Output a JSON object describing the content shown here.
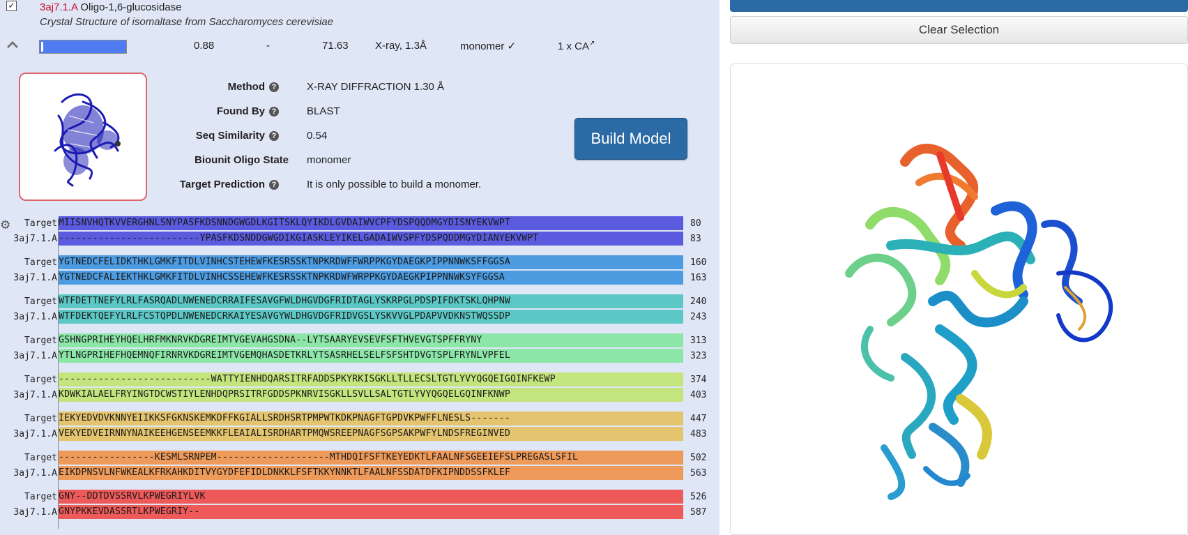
{
  "result": {
    "template_id": "3aj7.1.A",
    "name": "Oligo-1,6-glucosidase",
    "description": "Crystal Structure of isomaltase from Saccharomyces cerevisiae",
    "coverage_fraction": 0.97,
    "gmqe": "0.88",
    "qmean": "-",
    "identity": "71.63",
    "method_short": "X-ray, 1.3Å",
    "oligo_state": "monomer ✓",
    "ligands": "1 x CA"
  },
  "details": {
    "rows": [
      {
        "label": "Method",
        "value": "X-RAY DIFFRACTION 1.30 Å",
        "help": true
      },
      {
        "label": "Found By",
        "value": "BLAST",
        "help": true
      },
      {
        "label": "Seq Similarity",
        "value": "0.54",
        "help": true
      },
      {
        "label": "Biounit Oligo State",
        "value": "monomer",
        "help": false
      },
      {
        "label": "Target Prediction",
        "value": "It is only possible to build a monomer.",
        "help": true
      }
    ]
  },
  "buttons": {
    "build_model": "Build Model",
    "clear_selection": "Clear Selection"
  },
  "alignment": {
    "blocks": [
      {
        "rows": [
          {
            "label": "Target",
            "seq": "MIISNVHQTKVVERGHNLSNYPASFKDSNNDGWGDLKGITSKLQYIKDLGVDAIWVCPFYDSPQQDMGYDISNYEKVWPT",
            "end": "80",
            "color": "#5b5bdf"
          },
          {
            "label": "3aj7.1.A",
            "seq": "-------------------------YPASFKDSNDDGWGDIKGIASKLEYIKELGADAIWVSPFYDSPQDDMGYDIANYEKVWPT",
            "end": "83",
            "color": "#5b5bdf"
          }
        ]
      },
      {
        "rows": [
          {
            "label": "Target",
            "seq": "YGTNEDCFELIDKTHKLGMKFITDLVINHCSTEHEWFKESRSSKTNPKRDWFFWRPPKGYDAEGKPIPPNNWKSFFGGSA",
            "end": "160",
            "color": "#4d9be0"
          },
          {
            "label": "3aj7.1.A",
            "seq": "YGTNEDCFALIEKTHKLGMKFITDLVINHCSSEHEWFKESRSSKTNPKRDWFWRPPKGYDAEGKPIPPNNWKSYFGGSA",
            "end": "163",
            "color": "#4d9be0"
          }
        ]
      },
      {
        "rows": [
          {
            "label": "Target",
            "seq": "WTFDETTNEFYLRLFASRQADLNWENEDCRRAIFESAVGFWLDHGVDGFRIDTAGLYSKRPGLPDSPIFDKTSKLQHPNW",
            "end": "240",
            "color": "#5cc8c6"
          },
          {
            "label": "3aj7.1.A",
            "seq": "WTFDEKTQEFYLRLFCSTQPDLNWENEDCRKAIYESAVGYWLDHGVDGFRIDVGSLYSKVVGLPDAPVVDKNSTWQSSDP",
            "end": "243",
            "color": "#5cc8c6"
          }
        ]
      },
      {
        "rows": [
          {
            "label": "Target",
            "seq": "GSHNGPRIHEYHQELHRFMKNRVKDGREIMTVGEVAHGSDNA--LYTSAARYEVSEVFSFTHVEVGTSPFFRYNY",
            "end": "313",
            "color": "#8ce6a8"
          },
          {
            "label": "3aj7.1.A",
            "seq": "YTLNGPRIHEFHQEMNQFIRNRVKDGREIMTVGEMQHASDETKRLYTSASRHELSELFSFSHTDVGTSPLFRYNLVPFEL",
            "end": "323",
            "color": "#8ce6a8"
          }
        ]
      },
      {
        "rows": [
          {
            "label": "Target",
            "seq": "---------------------------WATTYIENHDQARSITRFADDSPKYRKISGKLLTLLECSLTGTLYVYQGQEIGQINFKEWP",
            "end": "374",
            "color": "#c4e47e"
          },
          {
            "label": "3aj7.1.A",
            "seq": "KDWKIALAELFRYINGTDCWSTIYLENHDQPRSITRFGDDSPKNRVISGKLLSVLLSALTGTLYVYQGQELGQINFKNWP",
            "end": "403",
            "color": "#c4e47e"
          }
        ]
      },
      {
        "rows": [
          {
            "label": "Target",
            "seq": "IEKYEDVDVKNNYEIIKKSFGKNSKEMKDFFKGIALLSRDHSRTPMPWTKDKPNAGFTGPDVKPWFFLNESLS-------",
            "end": "447",
            "color": "#e4c46e"
          },
          {
            "label": "3aj7.1.A",
            "seq": "VEKYEDVEIRNNYNAIKEEHGENSEEMKKFLEAIALISRDHARTPMQWSREEPNAGFSGPSAKPWFYLNDSFREGINVED",
            "end": "483",
            "color": "#e4c46e"
          }
        ]
      },
      {
        "rows": [
          {
            "label": "Target",
            "seq": "-----------------KESMLSRNPEM--------------------MTHDQIFSFTKEYEDKTLFAALNFSGEEIEFSLPREGASLSFIL",
            "end": "502",
            "color": "#ee9a5a"
          },
          {
            "label": "3aj7.1.A",
            "seq": "EIKDPNSVLNFWKEALKFRKAHKDITVYGYDFEFIDLDNKKLFSFTKKYNNKTLFAALNFSSDATDFKIPNDDSSFKLEF",
            "end": "563",
            "color": "#ee9a5a"
          }
        ]
      },
      {
        "rows": [
          {
            "label": "Target",
            "seq": "GNY--DDTDVSSRVLKPWEGRIYLVK",
            "end": "526",
            "color": "#ee5a5a"
          },
          {
            "label": "3aj7.1.A",
            "seq": "GNYPKKEVDASSRTLKPWEGRIY--",
            "end": "587",
            "color": "#ee5a5a"
          }
        ]
      }
    ]
  }
}
